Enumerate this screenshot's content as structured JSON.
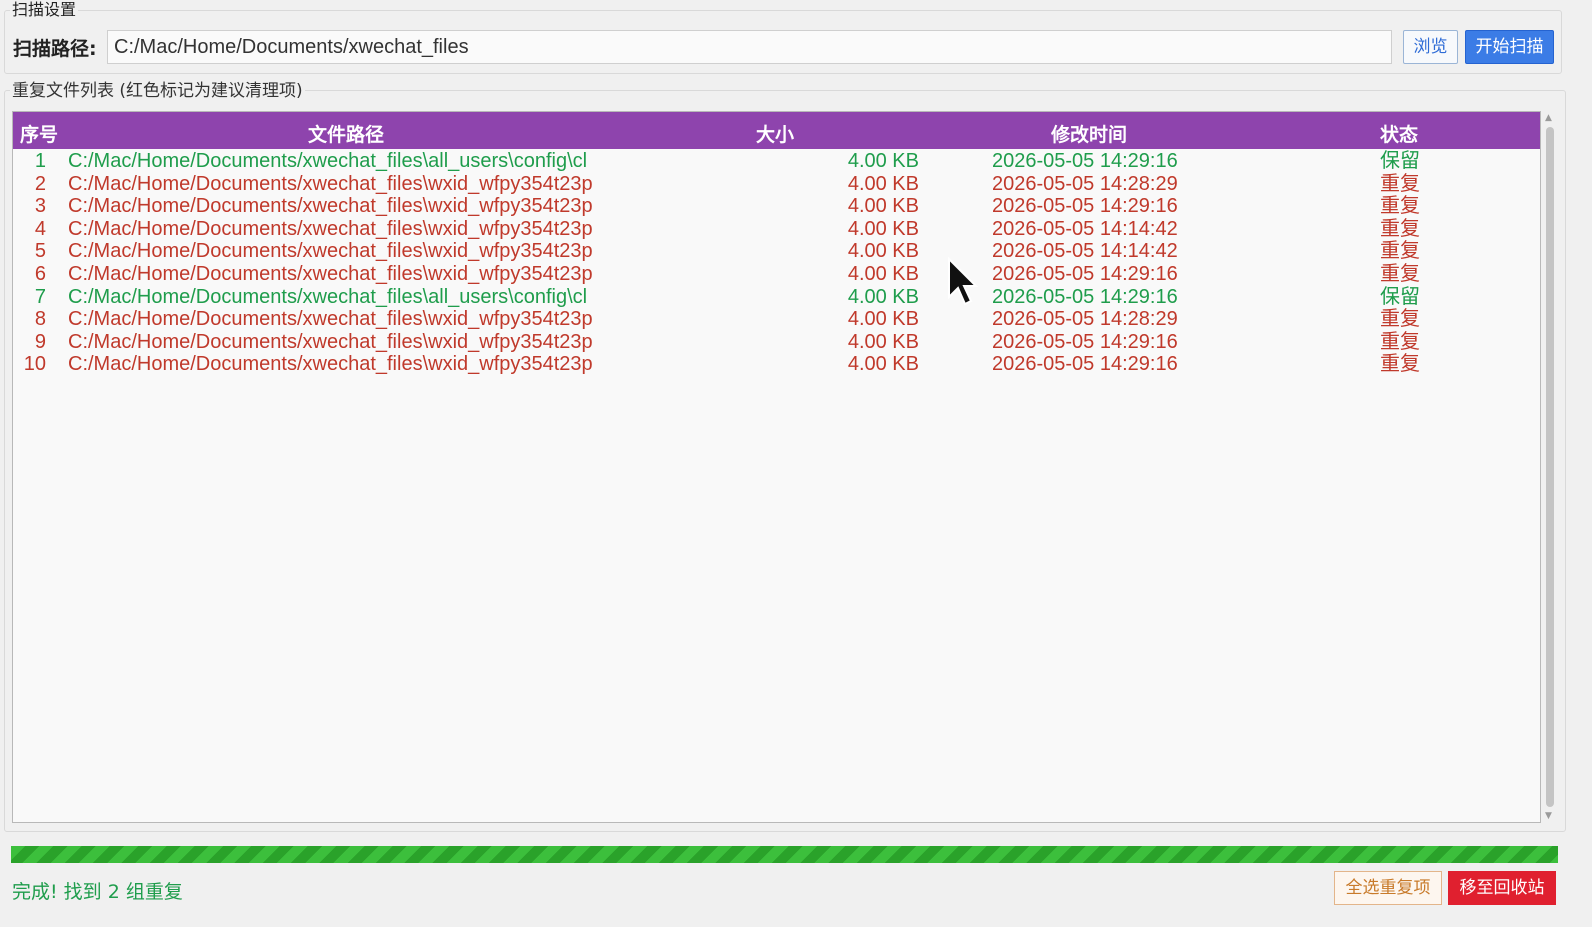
{
  "scan_settings": {
    "title": "扫描设置",
    "path_label": "扫描路径:",
    "path_value": "C:/Mac/Home/Documents/xwechat_files",
    "browse_label": "浏览",
    "start_label": "开始扫描"
  },
  "duplicate_list": {
    "title": "重复文件列表 (红色标记为建议清理项)",
    "columns": {
      "index": "序号",
      "path": "文件路径",
      "size": "大小",
      "modified": "修改时间",
      "status": "状态"
    },
    "rows": [
      {
        "index": "1",
        "path": "C:/Mac/Home/Documents/xwechat_files\\all_users\\config\\cl",
        "size": "4.00 KB",
        "modified": "2026-05-05 14:29:16",
        "status": "保留",
        "kind": "keep"
      },
      {
        "index": "2",
        "path": "C:/Mac/Home/Documents/xwechat_files\\wxid_wfpy354t23p",
        "size": "4.00 KB",
        "modified": "2026-05-05 14:28:29",
        "status": "重复",
        "kind": "dup"
      },
      {
        "index": "3",
        "path": "C:/Mac/Home/Documents/xwechat_files\\wxid_wfpy354t23p",
        "size": "4.00 KB",
        "modified": "2026-05-05 14:29:16",
        "status": "重复",
        "kind": "dup"
      },
      {
        "index": "4",
        "path": "C:/Mac/Home/Documents/xwechat_files\\wxid_wfpy354t23p",
        "size": "4.00 KB",
        "modified": "2026-05-05 14:14:42",
        "status": "重复",
        "kind": "dup"
      },
      {
        "index": "5",
        "path": "C:/Mac/Home/Documents/xwechat_files\\wxid_wfpy354t23p",
        "size": "4.00 KB",
        "modified": "2026-05-05 14:14:42",
        "status": "重复",
        "kind": "dup"
      },
      {
        "index": "6",
        "path": "C:/Mac/Home/Documents/xwechat_files\\wxid_wfpy354t23p",
        "size": "4.00 KB",
        "modified": "2026-05-05 14:29:16",
        "status": "重复",
        "kind": "dup"
      },
      {
        "index": "7",
        "path": "C:/Mac/Home/Documents/xwechat_files\\all_users\\config\\cl",
        "size": "4.00 KB",
        "modified": "2026-05-05 14:29:16",
        "status": "保留",
        "kind": "keep"
      },
      {
        "index": "8",
        "path": "C:/Mac/Home/Documents/xwechat_files\\wxid_wfpy354t23p",
        "size": "4.00 KB",
        "modified": "2026-05-05 14:28:29",
        "status": "重复",
        "kind": "dup"
      },
      {
        "index": "9",
        "path": "C:/Mac/Home/Documents/xwechat_files\\wxid_wfpy354t23p",
        "size": "4.00 KB",
        "modified": "2026-05-05 14:29:16",
        "status": "重复",
        "kind": "dup"
      },
      {
        "index": "10",
        "path": "C:/Mac/Home/Documents/xwechat_files\\wxid_wfpy354t23p",
        "size": "4.00 KB",
        "modified": "2026-05-05 14:29:16",
        "status": "重复",
        "kind": "dup"
      }
    ]
  },
  "progress": {
    "value_percent": 100
  },
  "status_text": "完成!  找到 2 组重复",
  "actions": {
    "select_duplicates_label": "全选重复项",
    "move_to_recycle_label": "移至回收站"
  },
  "colors": {
    "header_bg": "#8e44ad",
    "keep_text": "#1f9d4c",
    "duplicate_text": "#c0392b",
    "start_button": "#3b7ce6",
    "recycle_button": "#e0202f",
    "progress": "#3cbf3c"
  },
  "icons": {
    "cursor": "mouse-pointer-icon"
  }
}
